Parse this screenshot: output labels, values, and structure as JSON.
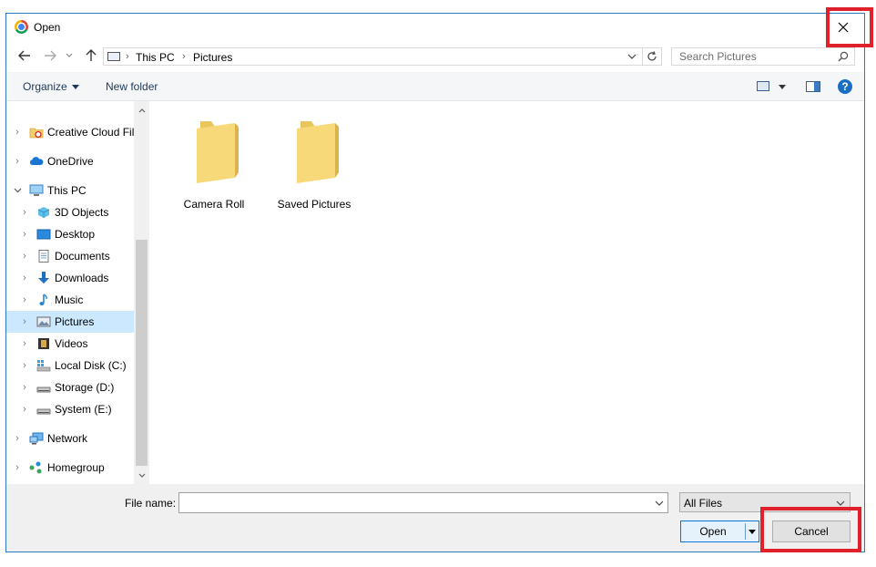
{
  "window": {
    "title": "Open",
    "app_icon": "chrome-icon",
    "accent": "#2b79c2",
    "highlight": "#e0202a"
  },
  "address": {
    "crumbs": [
      "This PC",
      "Pictures"
    ],
    "search_placeholder": "Search Pictures"
  },
  "toolbar": {
    "organize_label": "Organize",
    "new_folder_label": "New folder"
  },
  "nav_pane": {
    "items": [
      {
        "label": "Creative Cloud Fil",
        "icon": "creative-cloud-icon"
      },
      {
        "label": "OneDrive",
        "icon": "onedrive-icon"
      },
      {
        "label": "This PC",
        "icon": "this-pc-icon",
        "expanded": true
      },
      {
        "label": "3D Objects",
        "icon": "3d-objects-icon"
      },
      {
        "label": "Desktop",
        "icon": "desktop-icon"
      },
      {
        "label": "Documents",
        "icon": "documents-icon"
      },
      {
        "label": "Downloads",
        "icon": "downloads-icon"
      },
      {
        "label": "Music",
        "icon": "music-icon"
      },
      {
        "label": "Pictures",
        "icon": "pictures-icon",
        "selected": true
      },
      {
        "label": "Videos",
        "icon": "videos-icon"
      },
      {
        "label": "Local Disk (C:)",
        "icon": "local-disk-icon"
      },
      {
        "label": "Storage (D:)",
        "icon": "drive-icon"
      },
      {
        "label": "System (E:)",
        "icon": "drive-icon"
      },
      {
        "label": "Network",
        "icon": "network-icon"
      },
      {
        "label": "Homegroup",
        "icon": "homegroup-icon"
      }
    ]
  },
  "folders": [
    {
      "label": "Camera Roll"
    },
    {
      "label": "Saved Pictures"
    }
  ],
  "bottom": {
    "file_name_label": "File name:",
    "file_name_value": "",
    "filter_label": "All Files",
    "open_label": "Open",
    "cancel_label": "Cancel"
  }
}
